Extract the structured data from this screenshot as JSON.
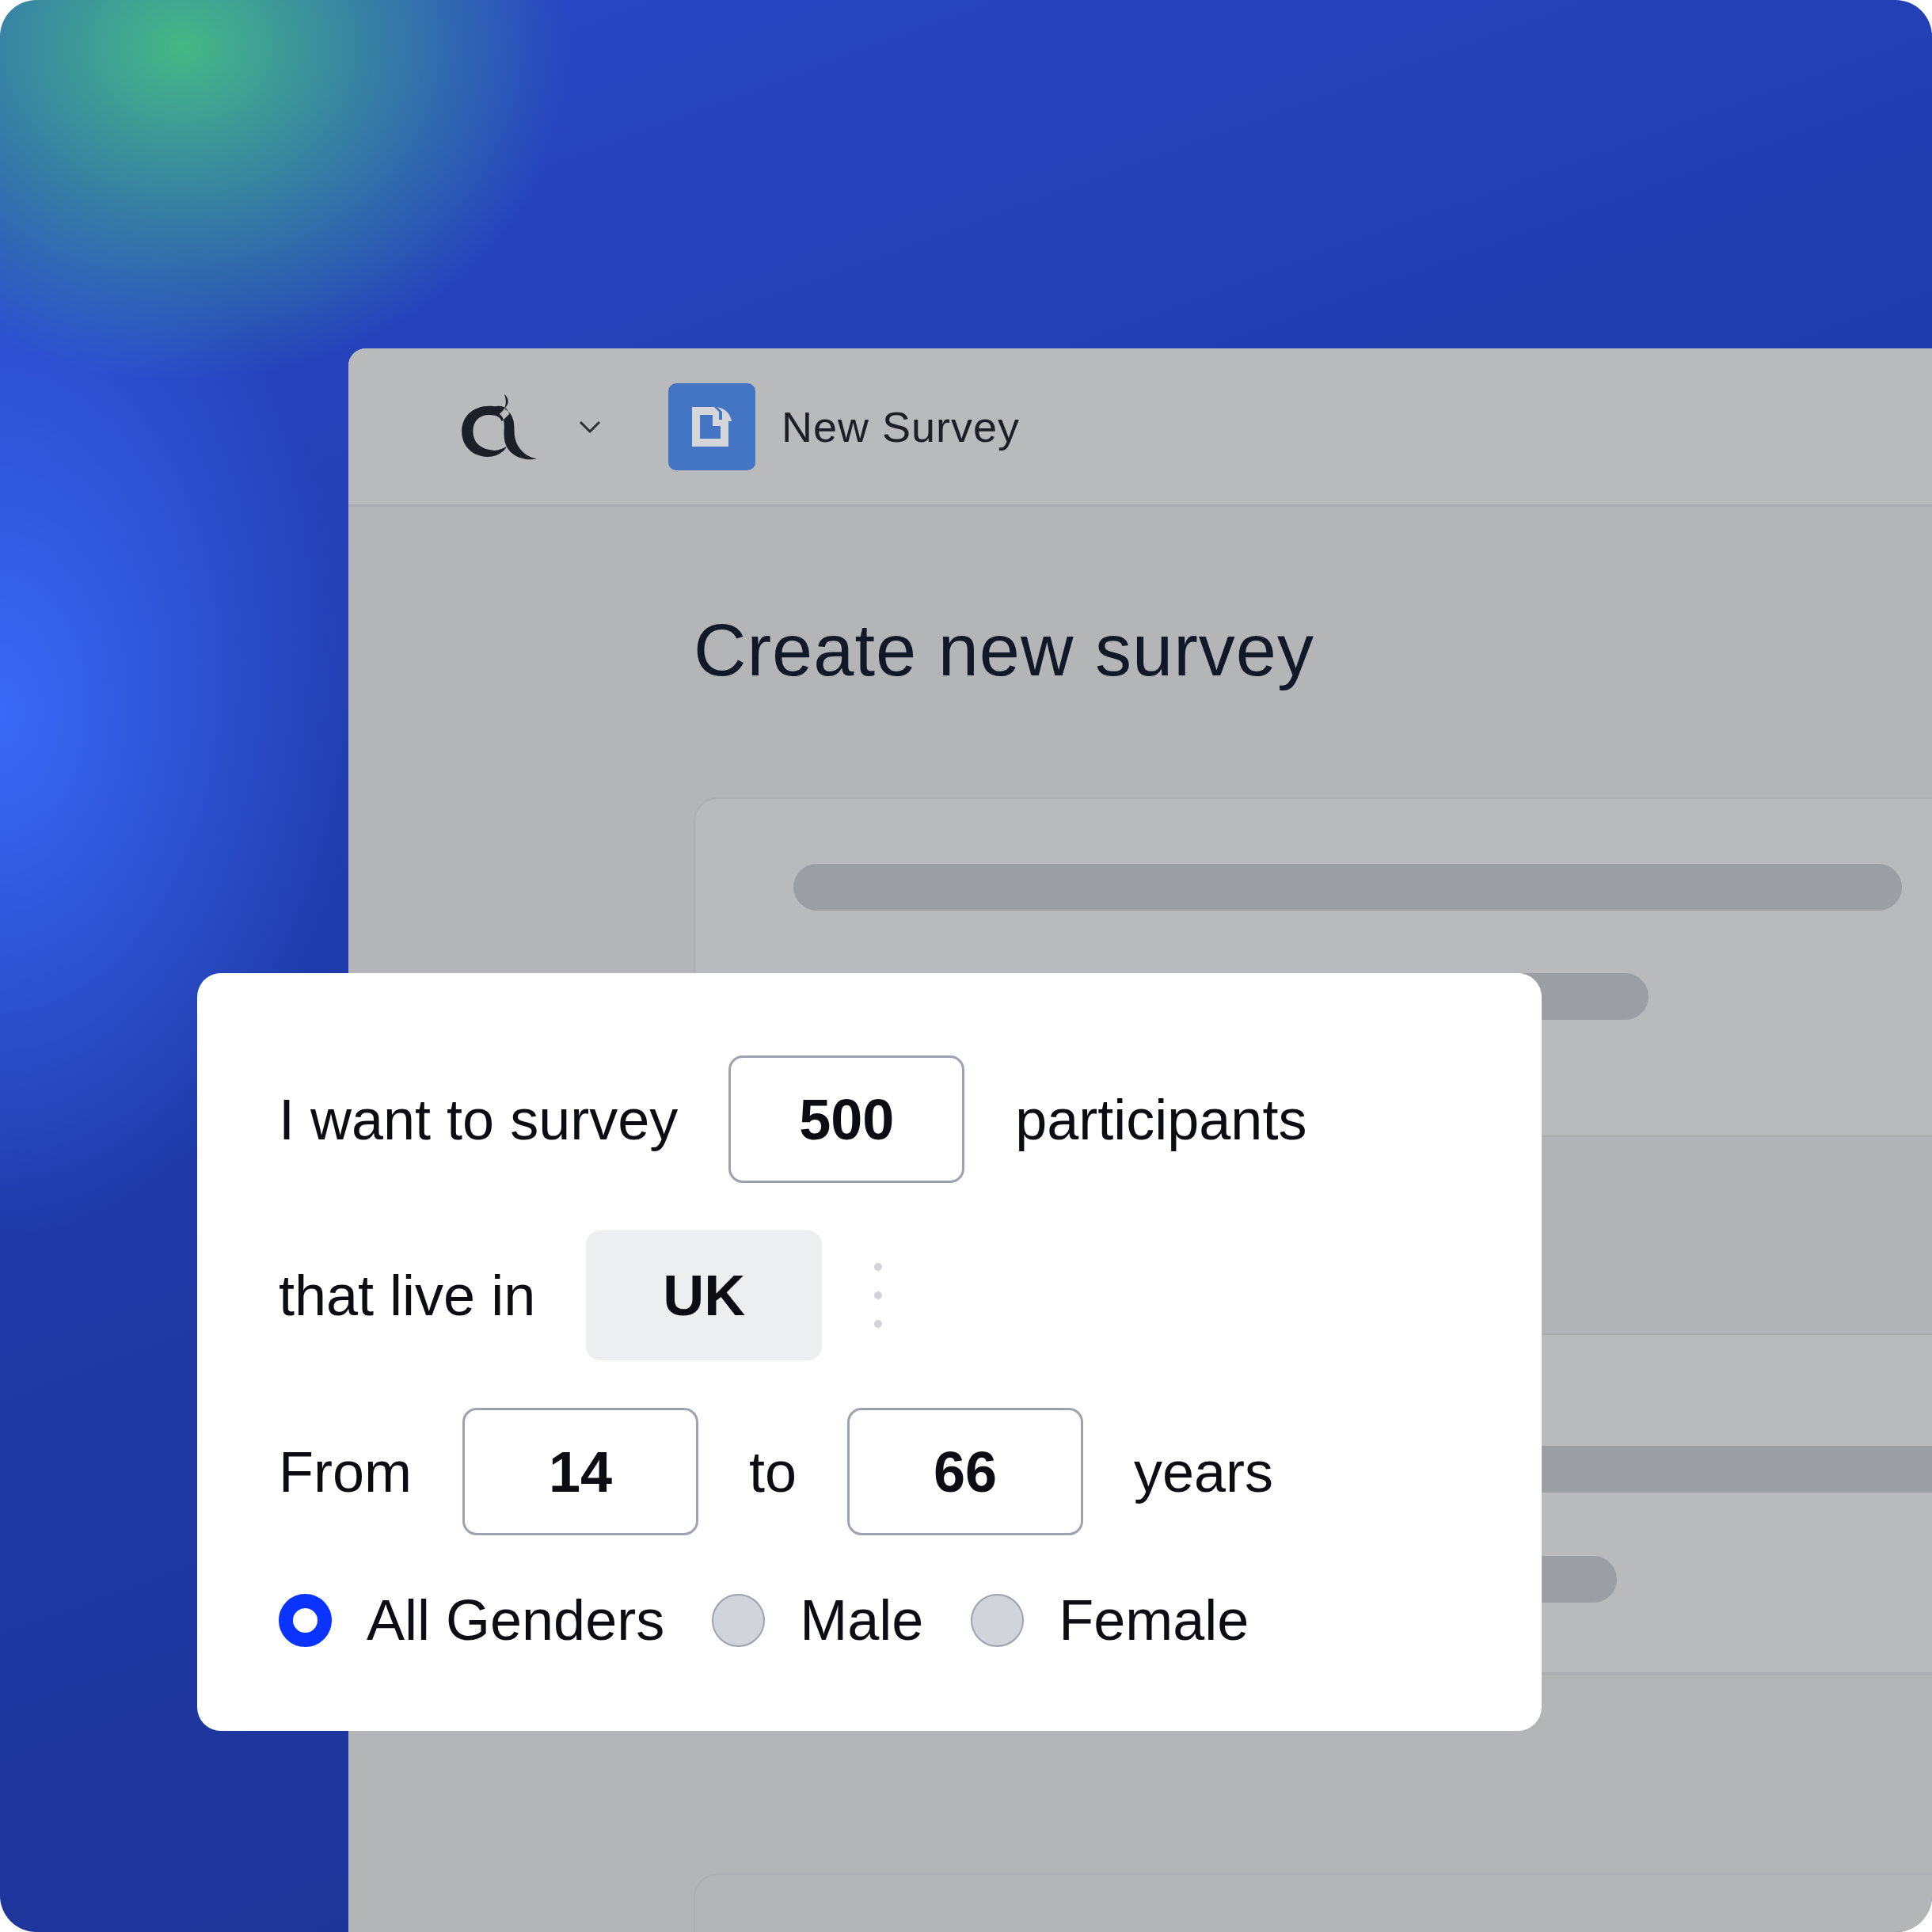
{
  "header": {
    "title": "New Survey"
  },
  "page": {
    "heading": "Create new survey"
  },
  "form": {
    "participants": {
      "label_before": "I want to survey",
      "value": "500",
      "label_after": "participants"
    },
    "location": {
      "label": "that live in",
      "value": "UK"
    },
    "age": {
      "from_label": "From",
      "from": "14",
      "to_label": "to",
      "to": "66",
      "unit": "years"
    },
    "genders": [
      {
        "label": "All Genders",
        "selected": true
      },
      {
        "label": "Male",
        "selected": false
      },
      {
        "label": "Female",
        "selected": false
      }
    ]
  }
}
